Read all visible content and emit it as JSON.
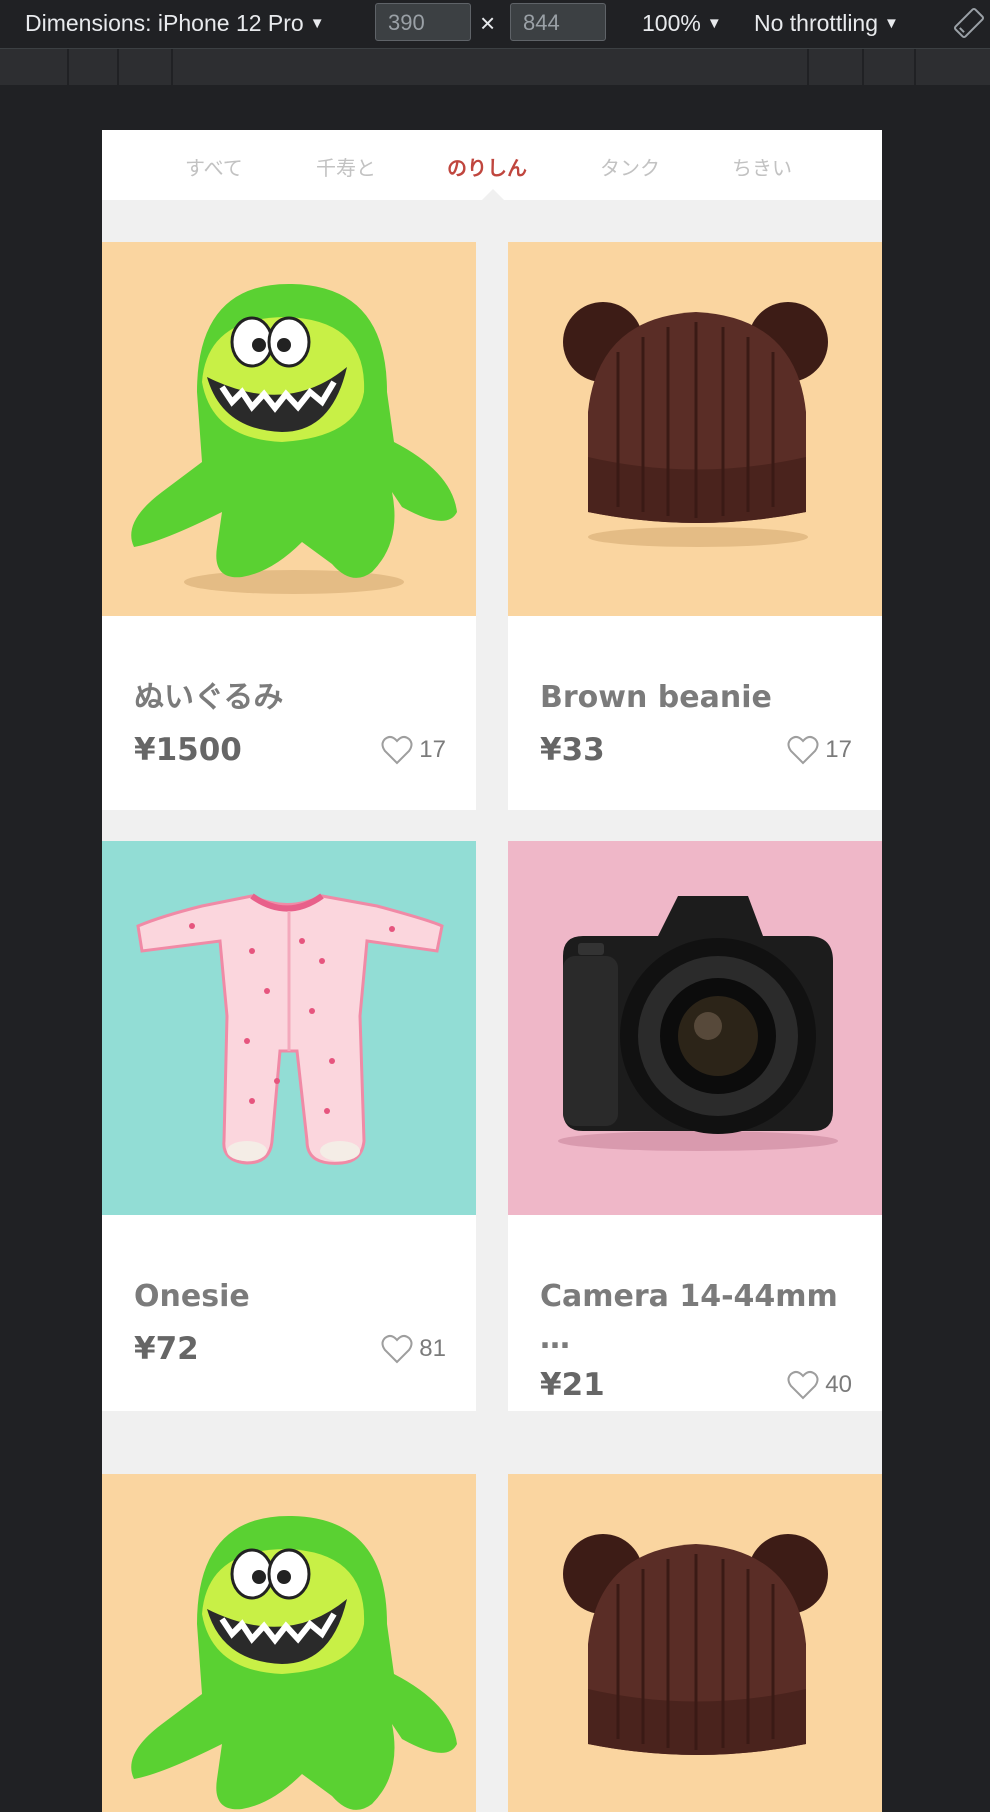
{
  "devtools": {
    "device_label": "Dimensions: iPhone 12 Pro",
    "width_value": "390",
    "times": "×",
    "height_value": "844",
    "zoom": "100%",
    "throttling": "No throttling"
  },
  "tabs": [
    {
      "label": "すべて",
      "active": false
    },
    {
      "label": "千寿と",
      "active": false
    },
    {
      "label": "のりしん",
      "active": true
    },
    {
      "label": "タンク",
      "active": false
    },
    {
      "label": "ちきい",
      "active": false
    }
  ],
  "products": [
    {
      "name": "ぬいぐるみ",
      "price": "¥1500",
      "likes": "17",
      "image": "green-plush-monster",
      "bg": "#fad5a0"
    },
    {
      "name": "Brown beanie",
      "price": "¥33",
      "likes": "17",
      "image": "brown-beanie-hat",
      "bg": "#fad5a0"
    },
    {
      "name": "Onesie",
      "price": "¥72",
      "likes": "81",
      "image": "pink-onesie",
      "bg": "#92ddd5"
    },
    {
      "name": "Camera 14-44mm …",
      "price": "¥21",
      "likes": "40",
      "image": "dslr-camera",
      "bg": "#efb7c8"
    },
    {
      "name": "",
      "price": "",
      "likes": "",
      "image": "green-plush-monster",
      "bg": "#fad5a0"
    },
    {
      "name": "",
      "price": "",
      "likes": "",
      "image": "brown-beanie-hat",
      "bg": "#fad5a0"
    }
  ],
  "colors": {
    "accent": "#c0463e",
    "tab_inactive": "#c2c2c2",
    "peach": "#fad5a0",
    "teal": "#92ddd5",
    "pink": "#efb7c8"
  }
}
